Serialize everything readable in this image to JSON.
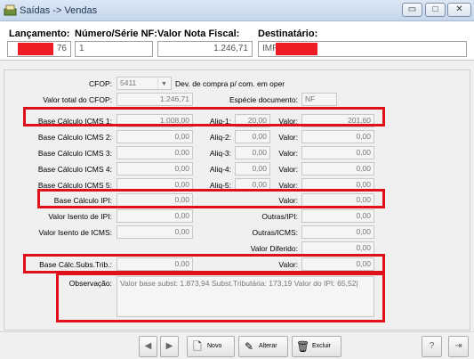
{
  "window": {
    "title": "Saídas -> Vendas",
    "minimize": "▭",
    "maximize": "□",
    "close": "✕"
  },
  "header": {
    "lancamento_label": "Lançamento:",
    "lancamento_value": "76",
    "numero_label": "Número/Série NF:",
    "numero_value": "1",
    "valor_label": "Valor Nota Fiscal:",
    "valor_value": "1.246,71",
    "destinatario_label": "Destinatário:",
    "destinatario_value": "IMP"
  },
  "form": {
    "cfop_label": "CFOP:",
    "cfop_value": "5411",
    "cfop_desc": "Dev. de compra p/ com. em oper",
    "valor_total_cfop_label": "Valor total do CFOP:",
    "valor_total_cfop": "1.246,71",
    "especie_label": "Espécie documento:",
    "especie_value": "NF",
    "rows": [
      {
        "base_label": "Base Cálculo ICMS 1:",
        "base": "1.008,00",
        "aliq_label": "Aliq-1:",
        "aliq": "20,00",
        "valor_label": "Valor:",
        "valor": "201,60"
      },
      {
        "base_label": "Base Cálculo ICMS 2:",
        "base": "0,00",
        "aliq_label": "Aliq-2:",
        "aliq": "0,00",
        "valor_label": "Valor:",
        "valor": "0,00"
      },
      {
        "base_label": "Base Cálculo ICMS 3:",
        "base": "0,00",
        "aliq_label": "Aliq-3:",
        "aliq": "0,00",
        "valor_label": "Valor:",
        "valor": "0,00"
      },
      {
        "base_label": "Base Cálculo ICMS 4:",
        "base": "0,00",
        "aliq_label": "Aliq-4:",
        "aliq": "0,00",
        "valor_label": "Valor:",
        "valor": "0,00"
      },
      {
        "base_label": "Base Cálculo ICMS 5:",
        "base": "0,00",
        "aliq_label": "Aliq-5:",
        "aliq": "0,00",
        "valor_label": "Valor:",
        "valor": "0,00"
      }
    ],
    "base_ipi_label": "Base Cálculo IPI:",
    "base_ipi": "0,00",
    "valor_ipi_label": "Valor:",
    "valor_ipi": "0,00",
    "isento_ipi_label": "Valor Isento de IPI:",
    "isento_ipi": "0,00",
    "outras_ipi_label": "Outras/IPI:",
    "outras_ipi": "0,00",
    "isento_icms_label": "Valor Isento de ICMS:",
    "isento_icms": "0,00",
    "outras_icms_label": "Outras/ICMS:",
    "outras_icms": "0,00",
    "valor_diferido_label": "Valor Diferido:",
    "valor_diferido": "0,00",
    "base_subs_label": "Base Cálc.Subs.Trib.:",
    "base_subs": "0,00",
    "valor_subs_label": "Valor:",
    "valor_subs": "0,00",
    "observacao_label": "Observação:",
    "observacao": "Valor base subst: 1.873,94 Subst.Tributária: 173,19 Valor do IPI: 65,52|"
  },
  "toolbar": {
    "prev": "◀",
    "next": "▶",
    "novo": "Novo",
    "alterar": "Alterar",
    "excluir": "Excluir"
  },
  "colors": {
    "highlight": "#e0101b",
    "redact": "#ee1c24"
  }
}
